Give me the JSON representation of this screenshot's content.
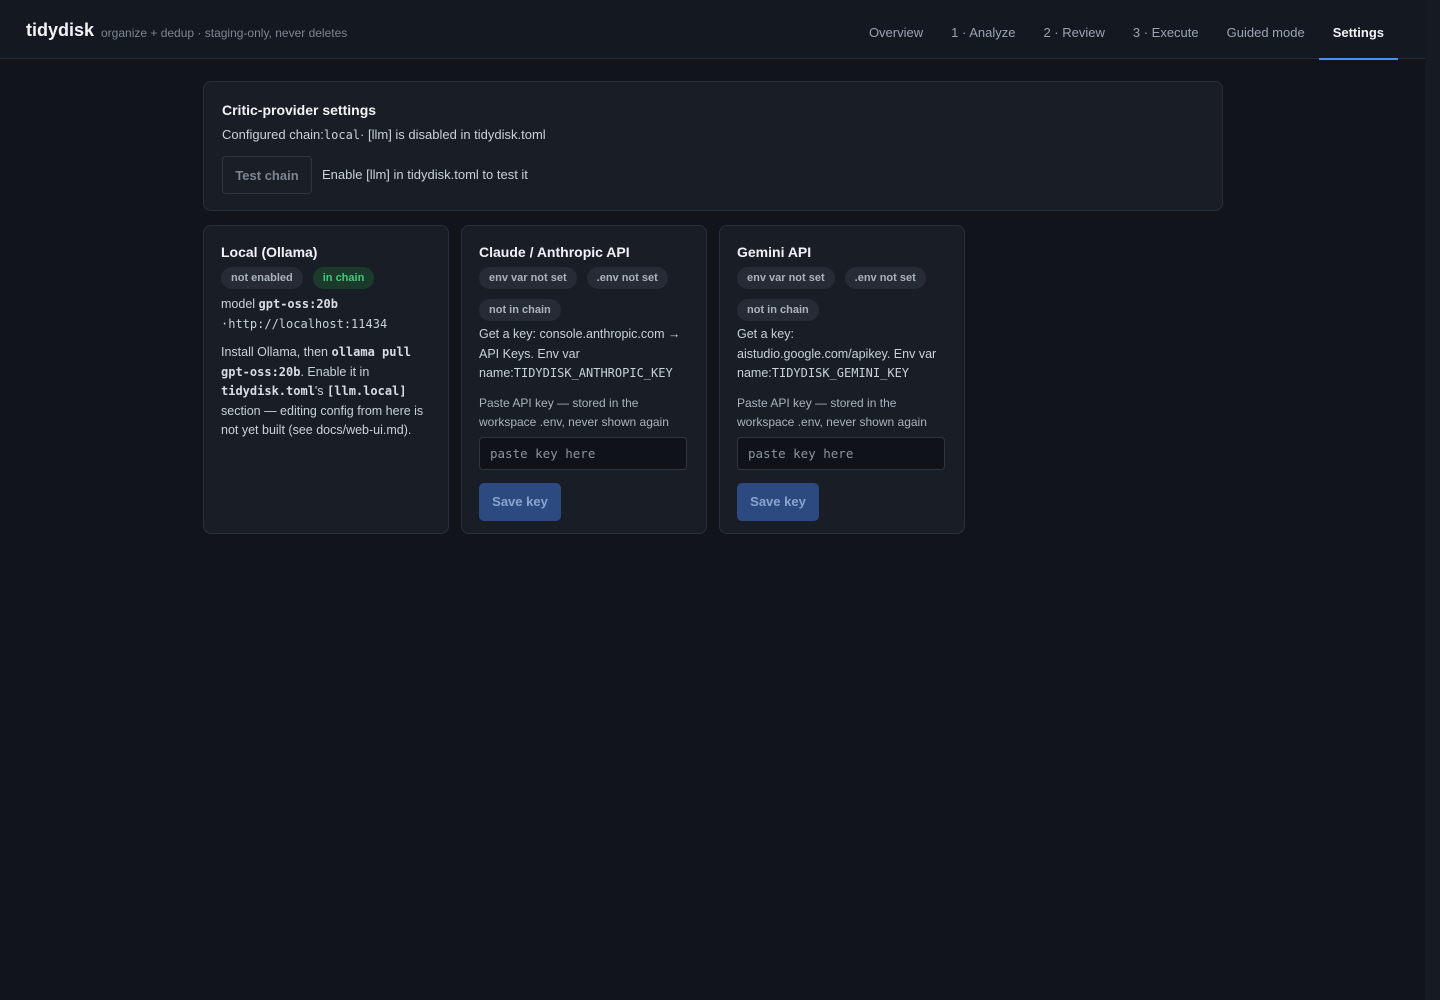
{
  "app": {
    "brand": "tidydisk",
    "tagline": "organize + dedup · staging-only, never deletes"
  },
  "nav": [
    {
      "label": "Overview",
      "active": false
    },
    {
      "label": "1 · Analyze",
      "active": false
    },
    {
      "label": "2 · Review",
      "active": false
    },
    {
      "label": "3 · Execute",
      "active": false
    },
    {
      "label": "Guided mode",
      "active": false
    },
    {
      "label": "Settings",
      "active": true
    }
  ],
  "critic": {
    "title": "Critic-provider settings",
    "chain_prefix": "Configured chain:",
    "chain_value": "local",
    "chain_suffix": "· [llm] is disabled in tidydisk.toml",
    "test_button": "Test chain",
    "test_hint": "Enable [llm] in tidydisk.toml to test it"
  },
  "local": {
    "title": "Local (Ollama)",
    "badges": [
      "not enabled",
      "in chain"
    ],
    "model_label": "model ",
    "model": "gpt-oss:20b",
    "url": "·http://localhost:11434",
    "install_1": "Install Ollama, then ",
    "install_cmd": "ollama pull gpt-oss:20b",
    "install_2": ". Enable it in ",
    "install_file": "tidydisk.toml",
    "install_3": "'s ",
    "install_section": "[llm.local]",
    "install_4": " section — editing config from here is not yet built (see docs/web-ui.md)."
  },
  "claude": {
    "title": "Claude / Anthropic API",
    "badges": [
      "env var not set",
      ".env not set",
      "not in chain"
    ],
    "key_text": "Get a key: console.anthropic.com → API Keys. Env var name:",
    "env_name": "TIDYDISK_ANTHROPIC_KEY",
    "paste_label": "Paste API key — stored in the workspace .env, never shown again",
    "placeholder": "paste key here",
    "save_label": "Save key"
  },
  "gemini": {
    "title": "Gemini API",
    "badges": [
      "env var not set",
      ".env not set",
      "not in chain"
    ],
    "key_text": "Get a key: aistudio.google.com/apikey. Env var name:",
    "env_name": "TIDYDISK_GEMINI_KEY",
    "paste_label": "Paste API key — stored in the workspace .env, never shown again",
    "placeholder": "paste key here",
    "save_label": "Save key"
  },
  "colors": {
    "accent": "#4c8ff0",
    "background": "#11141b",
    "panel": "#191d26",
    "badge_green": "#3fc97a",
    "save_button": "#2c4a80"
  }
}
